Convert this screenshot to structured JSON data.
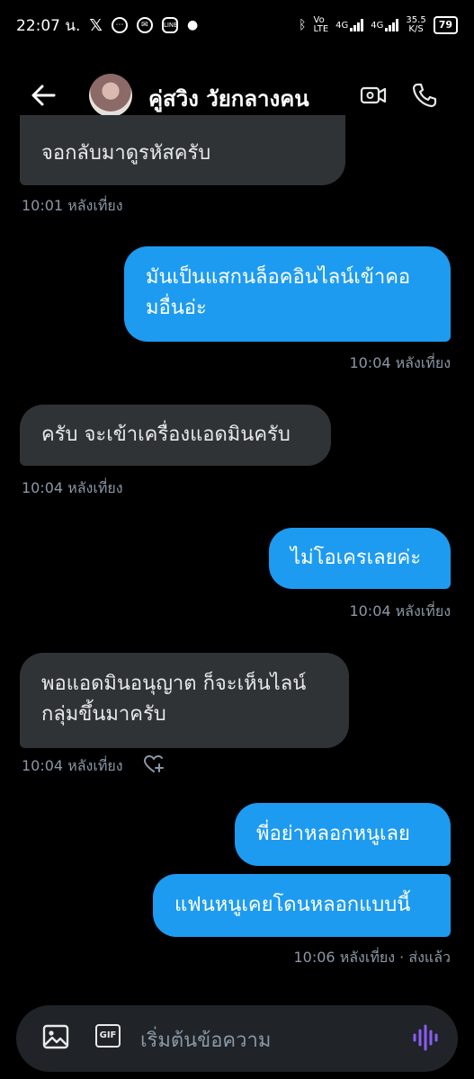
{
  "status_bar": {
    "time": "22:07 น.",
    "network_left": "Vo",
    "network_left_sub": "LTE",
    "net_4g_1": "4G",
    "net_4g_2": "4G",
    "speed_value": "35.5",
    "speed_unit": "K/S",
    "battery": "79"
  },
  "header": {
    "title": "คู่สวิง วัยกลางคน"
  },
  "messages": [
    {
      "dir": "in",
      "text": "จอกลับมาดูรหัสครับ",
      "time": "10:01 หลังเที่ยง"
    },
    {
      "dir": "out",
      "line1": "มันเป็นแสกนล็อคอินไลน์เข้าคอ",
      "line2": "มอื่นอ่ะ",
      "time": "10:04 หลังเที่ยง"
    },
    {
      "dir": "in",
      "text": "ครับ จะเข้าเครื่องแอดมินครับ",
      "time": "10:04 หลังเที่ยง"
    },
    {
      "dir": "out",
      "text": "ไม่โอเครเลยค่ะ",
      "time": "10:04 หลังเที่ยง"
    },
    {
      "dir": "in",
      "line1": "พอแอดมินอนุญาต ก็จะเห็นไลน์",
      "line2": "กลุ่มขึ้นมาครับ",
      "time": "10:04 หลังเที่ยง"
    },
    {
      "dir": "out",
      "text": "พี่อย่าหลอกหนูเลย"
    },
    {
      "dir": "out",
      "text": "แฟนหนูเคยโดนหลอกแบบนี้",
      "time": "10:06 หลังเที่ยง · ส่งแล้ว"
    }
  ],
  "composer": {
    "placeholder": "เริ่มต้นข้อความ",
    "gif_label": "GIF"
  },
  "colors": {
    "background": "#000000",
    "incoming_bubble": "#2f3336",
    "outgoing_bubble": "#1d9bf0",
    "accent_voice": "#8b5cf6"
  },
  "icons": [
    "back-arrow-icon",
    "video-call-icon",
    "phone-icon",
    "heart-plus-icon",
    "image-icon",
    "gif-icon",
    "voice-wave-icon"
  ]
}
